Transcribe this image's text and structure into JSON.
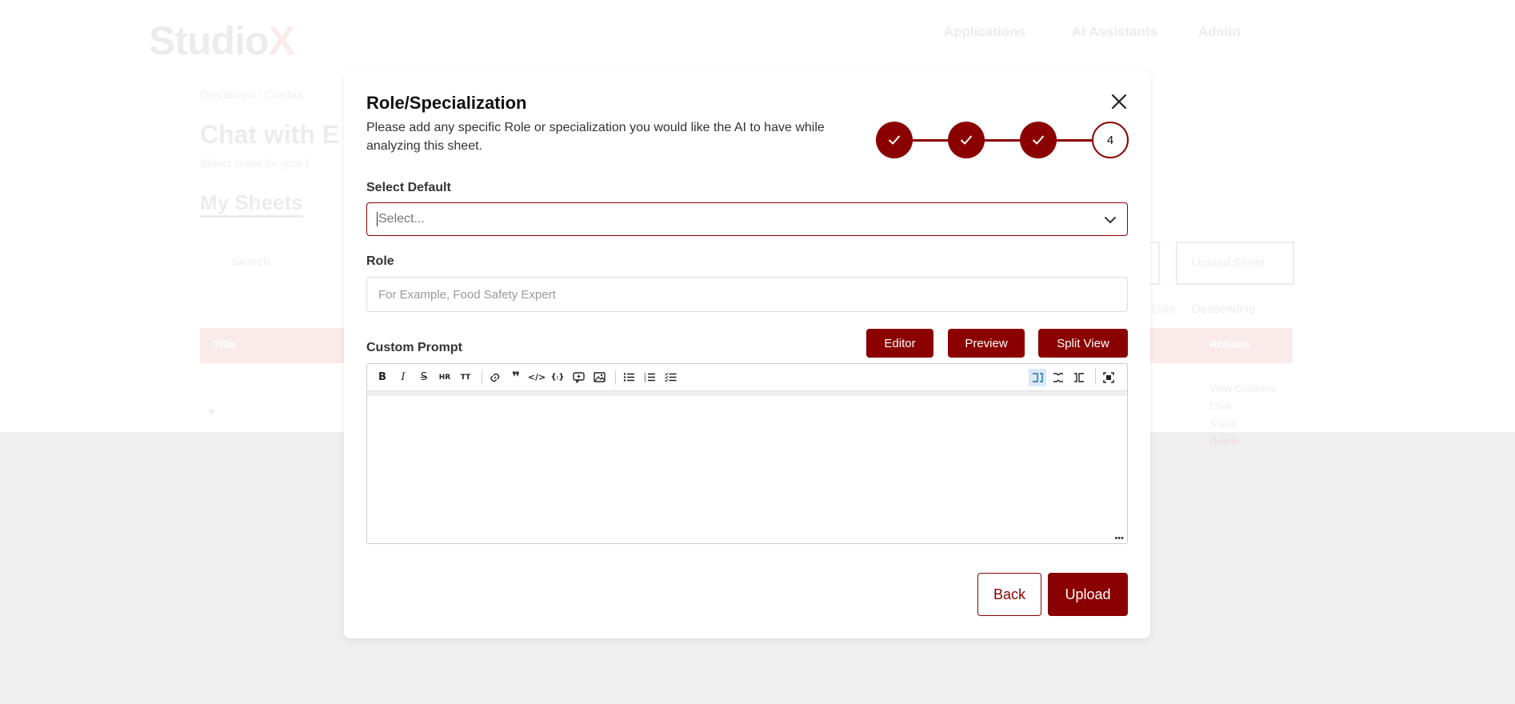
{
  "background": {
    "logo_main": "Studio",
    "logo_accent": "X",
    "nav": [
      "Applications",
      "AI Assistants",
      "Admin"
    ],
    "breadcrumb": "Dashboard / Chatbot",
    "page_title": "Chat with E",
    "page_subtitle": "Select sheet for your f",
    "section_title": "My Sheets",
    "search_placeholder": "Search",
    "upload_sheet": "Upload Sheet",
    "sort_label": "Date",
    "sort_order": "Descending",
    "table_col_name": "Title",
    "table_col_actions": "Actions",
    "row_actions": [
      "View Columns",
      "Chat",
      "Share",
      "Delete"
    ]
  },
  "modal": {
    "title": "Role/Specialization",
    "description": "Please add any specific Role or specialization you would like the AI to have while analyzing this sheet.",
    "current_step": "4",
    "select_label": "Select Default",
    "select_placeholder": "Select...",
    "role_label": "Role",
    "role_placeholder": "For Example, Food Safety Expert",
    "prompt_label": "Custom Prompt",
    "editor_btn": "Editor",
    "preview_btn": "Preview",
    "split_btn": "Split View",
    "back_btn": "Back",
    "upload_btn": "Upload"
  },
  "colors": {
    "accent": "#8b0000",
    "brand_red": "#c0181d"
  },
  "toolbar_icons": [
    "bold-icon",
    "italic-icon",
    "strikethrough-icon",
    "hr-icon",
    "title-icon",
    "link-icon",
    "quote-icon",
    "code-icon",
    "code-block-icon",
    "comment-icon",
    "image-icon",
    "unordered-list-icon",
    "ordered-list-icon",
    "checked-list-icon"
  ]
}
